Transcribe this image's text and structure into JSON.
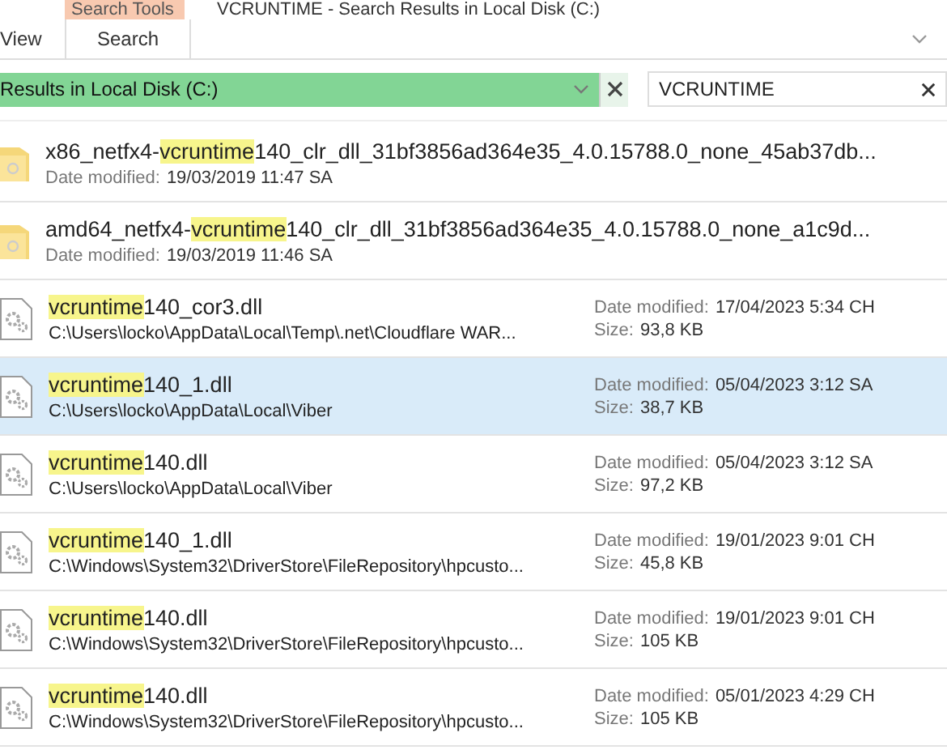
{
  "ribbon": {
    "context_tab": "Search Tools",
    "title": "VCRUNTIME - Search Results in Local Disk (C:)",
    "tabs": [
      {
        "label": "View",
        "selected": false
      },
      {
        "label": "Search",
        "selected": true
      }
    ]
  },
  "address": {
    "text": "Results in Local Disk (C:)"
  },
  "search": {
    "value": "VCRUNTIME"
  },
  "results": [
    {
      "kind": "folder",
      "selected": false,
      "name": [
        {
          "text": "x86_netfx4-",
          "highlight": false
        },
        {
          "text": "vcruntime",
          "highlight": true
        },
        {
          "text": "140_clr_dll_31bf3856ad364e35_4.0.15788.0_none_45ab37db...",
          "highlight": false
        }
      ],
      "date_label": "Date modified:",
      "date": "19/03/2019 11:47 SA"
    },
    {
      "kind": "folder",
      "selected": false,
      "name": [
        {
          "text": "amd64_netfx4-",
          "highlight": false
        },
        {
          "text": "vcruntime",
          "highlight": true
        },
        {
          "text": "140_clr_dll_31bf3856ad364e35_4.0.15788.0_none_a1c9d...",
          "highlight": false
        }
      ],
      "date_label": "Date modified:",
      "date": "19/03/2019 11:46 SA"
    },
    {
      "kind": "file",
      "selected": false,
      "name": [
        {
          "text": "vcruntime",
          "highlight": true
        },
        {
          "text": "140_cor3.dll",
          "highlight": false
        }
      ],
      "path": "C:\\Users\\locko\\AppData\\Local\\Temp\\.net\\Cloudflare WAR...",
      "date_label": "Date modified:",
      "date": "17/04/2023 5:34 CH",
      "size_label": "Size:",
      "size": "93,8 KB"
    },
    {
      "kind": "file",
      "selected": true,
      "name": [
        {
          "text": "vcruntime",
          "highlight": true
        },
        {
          "text": "140_1.dll",
          "highlight": false
        }
      ],
      "path": "C:\\Users\\locko\\AppData\\Local\\Viber",
      "date_label": "Date modified:",
      "date": "05/04/2023 3:12 SA",
      "size_label": "Size:",
      "size": "38,7 KB"
    },
    {
      "kind": "file",
      "selected": false,
      "name": [
        {
          "text": "vcruntime",
          "highlight": true
        },
        {
          "text": "140.dll",
          "highlight": false
        }
      ],
      "path": "C:\\Users\\locko\\AppData\\Local\\Viber",
      "date_label": "Date modified:",
      "date": "05/04/2023 3:12 SA",
      "size_label": "Size:",
      "size": "97,2 KB"
    },
    {
      "kind": "file",
      "selected": false,
      "name": [
        {
          "text": "vcruntime",
          "highlight": true
        },
        {
          "text": "140_1.dll",
          "highlight": false
        }
      ],
      "path": "C:\\Windows\\System32\\DriverStore\\FileRepository\\hpcusto...",
      "date_label": "Date modified:",
      "date": "19/01/2023 9:01 CH",
      "size_label": "Size:",
      "size": "45,8 KB"
    },
    {
      "kind": "file",
      "selected": false,
      "name": [
        {
          "text": "vcruntime",
          "highlight": true
        },
        {
          "text": "140.dll",
          "highlight": false
        }
      ],
      "path": "C:\\Windows\\System32\\DriverStore\\FileRepository\\hpcusto...",
      "date_label": "Date modified:",
      "date": "19/01/2023 9:01 CH",
      "size_label": "Size:",
      "size": "105 KB"
    },
    {
      "kind": "file",
      "selected": false,
      "name": [
        {
          "text": "vcruntime",
          "highlight": true
        },
        {
          "text": "140.dll",
          "highlight": false
        }
      ],
      "path": "C:\\Windows\\System32\\DriverStore\\FileRepository\\hpcusto...",
      "date_label": "Date modified:",
      "date": "05/01/2023 4:29 CH",
      "size_label": "Size:",
      "size": "105 KB"
    }
  ]
}
